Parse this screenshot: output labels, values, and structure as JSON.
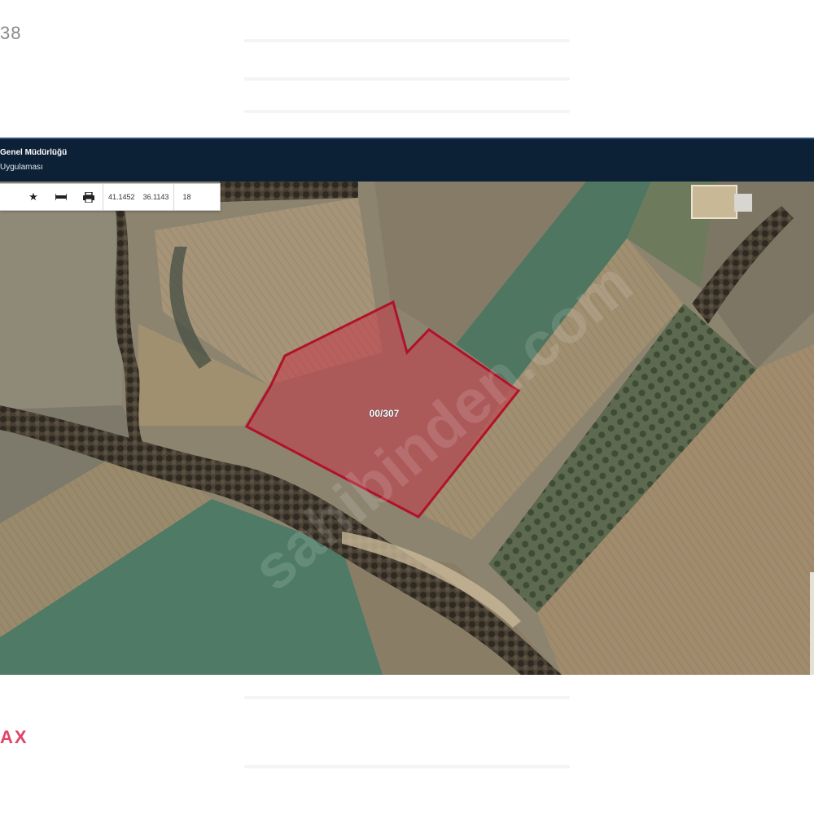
{
  "listing": {
    "number_fragment": "38",
    "brand_fragment": "AX"
  },
  "app": {
    "header": {
      "title": "Genel Müdürlüğü",
      "subtitle": "Uygulaması"
    },
    "toolbar": {
      "favorite_icon": "star-icon",
      "measure_icon": "ruler-icon",
      "print_icon": "printer-icon",
      "lat": "41.1452",
      "lon": "36.1143",
      "zoom": "18"
    },
    "map": {
      "parcel_label": "00/307",
      "watermark": "sahibinden.com",
      "colors": {
        "parcel_border": "#b0122a",
        "parcel_fill": "#c23b4a",
        "header_bg": "#0c2136",
        "brand": "#e0456a"
      }
    }
  }
}
